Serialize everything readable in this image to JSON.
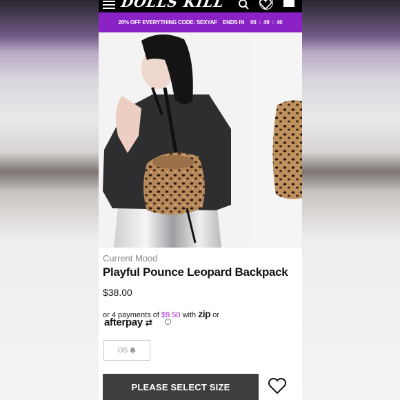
{
  "header": {
    "logo_text": "DOLLS KILL"
  },
  "promo": {
    "text": "20% OFF EVERYTHING CODE: SEXYAF",
    "ends_label": "ENDS IN",
    "hours": "00",
    "minutes": "49",
    "seconds": "40"
  },
  "product": {
    "brand": "Current Mood",
    "name": "Playful Pounce Leopard Backpack",
    "price": "$38.00",
    "payment": {
      "prefix": "or 4 payments of",
      "amount": "$9.50",
      "with": "with",
      "zip_label": "zip",
      "or": "or",
      "afterpay_label": "afterpay"
    },
    "size_option": "OS",
    "cta_label": "PLEASE SELECT SIZE"
  },
  "colors": {
    "promo_bg": "#8a22c6",
    "accent": "#a11ad0",
    "cta_bg": "#3e3e3e"
  },
  "icons": [
    "menu-icon",
    "search-icon",
    "heart-icon",
    "cart-icon",
    "bell-icon",
    "info-icon",
    "wishlist-heart-icon"
  ]
}
